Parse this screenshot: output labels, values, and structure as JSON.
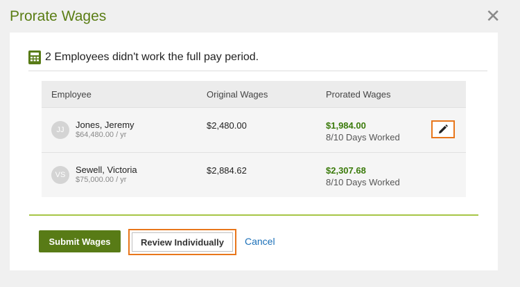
{
  "dialog": {
    "title": "Prorate Wages",
    "close_glyph": "✕"
  },
  "notice": {
    "icon": "calculator-icon",
    "text": "2 Employees didn't work the full pay period."
  },
  "table": {
    "headers": [
      "Employee",
      "Original Wages",
      "Prorated Wages"
    ],
    "rows": [
      {
        "initials": "JJ",
        "name": "Jones, Jeremy",
        "salary": "$64,480.00 / yr",
        "original": "$2,480.00",
        "prorated": "$1,984.00",
        "days": "8/10 Days Worked",
        "editable": true
      },
      {
        "initials": "VS",
        "name": "Sewell, Victoria",
        "salary": "$75,000.00 / yr",
        "original": "$2,884.62",
        "prorated": "$2,307.68",
        "days": "8/10 Days Worked",
        "editable": false
      }
    ]
  },
  "actions": {
    "submit_label": "Submit Wages",
    "review_label": "Review Individually",
    "cancel_label": "Cancel"
  },
  "colors": {
    "brand_green": "#587b16",
    "title_green": "#5a7d14",
    "prorated_green": "#3a7a0a",
    "highlight_orange": "#e8761b",
    "link_blue": "#1a6fb8"
  }
}
